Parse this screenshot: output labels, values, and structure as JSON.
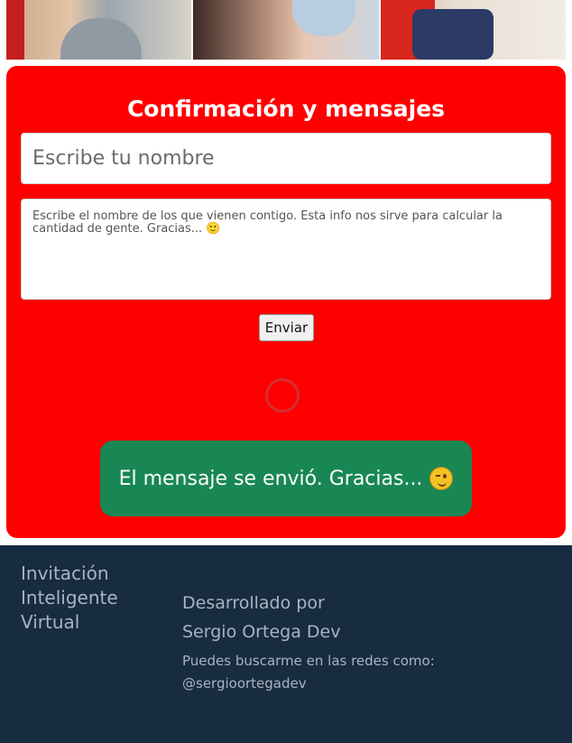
{
  "header_photos": [
    {
      "name": "photo-child"
    },
    {
      "name": "photo-mother-child"
    },
    {
      "name": "photo-children-red"
    }
  ],
  "rsvp": {
    "title": "Confirmación y mensajes",
    "name_placeholder": "Escribe tu nombre",
    "guests_placeholder": "Escribe el nombre de los que vienen contigo. Esta info nos sirve para calcular la cantidad de gente. Gracias... 🙂",
    "send_label": "Enviar",
    "success_message": "El mensaje se envió. Gracias...",
    "success_emoji_icon": "wink-emoji-icon",
    "card_color": "#ff0000",
    "success_color": "#198754"
  },
  "footer": {
    "brand_lines": [
      "Invitación",
      "Inteligente",
      "Virtual"
    ],
    "developed_by_label": "Desarrollado por",
    "developer_name": "Sergio Ortega Dev",
    "social_note": "Puedes buscarme en las redes como:",
    "social_handle": "@sergioortegadev",
    "background_color": "#172b41"
  }
}
